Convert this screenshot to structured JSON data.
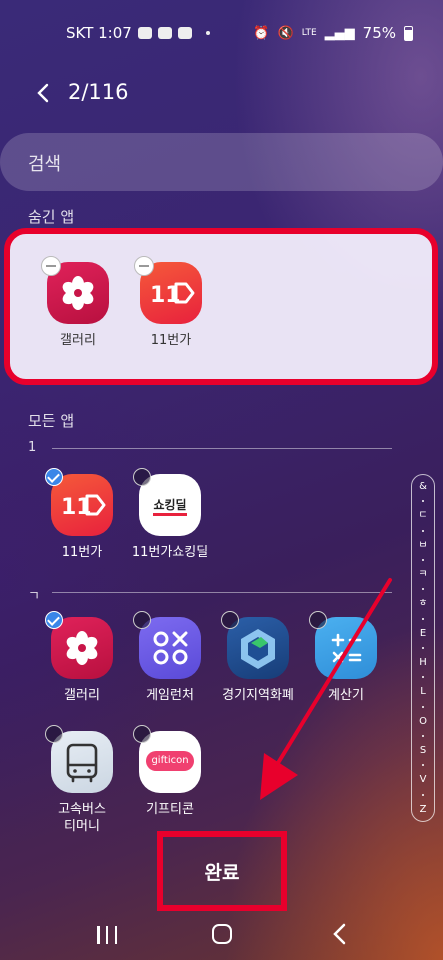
{
  "status": {
    "carrier_time": "SKT 1:07",
    "battery": "75%",
    "lte": "LTE"
  },
  "header": {
    "title": "2/116"
  },
  "search": {
    "placeholder": "검색"
  },
  "hidden_section": {
    "label": "숨긴 앱",
    "apps": [
      {
        "name": "갤러리",
        "icon": "gallery-flower-icon"
      },
      {
        "name": "11번가",
        "icon": "11st-icon"
      }
    ]
  },
  "all_section": {
    "label": "모든 앱",
    "groups": [
      {
        "header": "1",
        "apps": [
          {
            "name": "11번가",
            "checked": true,
            "icon": "11st-icon"
          },
          {
            "name": "11번가쇼킹딜",
            "checked": false,
            "icon": "shocking-deal-icon",
            "badge": "쇼킹딜"
          }
        ]
      },
      {
        "header": "ㄱ",
        "apps": [
          {
            "name": "갤러리",
            "checked": true,
            "icon": "gallery-flower-icon"
          },
          {
            "name": "게임런처",
            "checked": false,
            "icon": "game-launcher-icon"
          },
          {
            "name": "경기지역화폐",
            "checked": false,
            "icon": "gyeonggi-currency-icon"
          },
          {
            "name": "계산기",
            "checked": false,
            "icon": "calculator-icon"
          },
          {
            "name": "고속버스\n티머니",
            "checked": false,
            "icon": "bus-icon"
          },
          {
            "name": "기프티콘",
            "checked": false,
            "icon": "gifticon-icon",
            "badge": "gifticon"
          }
        ]
      }
    ]
  },
  "index_bar": [
    "&",
    "ㄷ",
    "ㅂ",
    "ㅋ",
    "ㅎ",
    "E",
    "H",
    "L",
    "O",
    "S",
    "V",
    "Z"
  ],
  "done_button": {
    "label": "완료"
  },
  "colors": {
    "highlight": "#e8002c",
    "check": "#3a86e8"
  }
}
